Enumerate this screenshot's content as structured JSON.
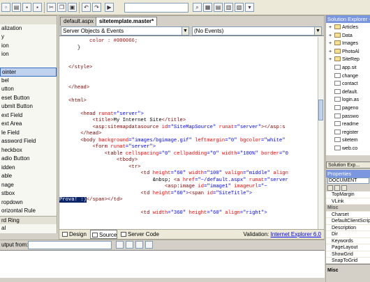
{
  "editor": {
    "tabs": [
      {
        "label": "default.aspx"
      },
      {
        "label": "sitetemplate.master*"
      }
    ],
    "object_combo": "Server Objects & Events",
    "event_combo": "(No Events)",
    "code_lines": [
      {
        "i": 0,
        "segs": [
          {
            "t": "          color : #000066;",
            "c": "css"
          }
        ]
      },
      {
        "i": 1,
        "segs": [
          {
            "t": "      }",
            "c": "txt"
          }
        ]
      },
      {
        "i": 2,
        "segs": []
      },
      {
        "i": 3,
        "segs": []
      },
      {
        "i": 4,
        "segs": [
          {
            "t": "   </style>",
            "c": "tag"
          }
        ]
      },
      {
        "i": 5,
        "segs": []
      },
      {
        "i": 6,
        "segs": []
      },
      {
        "i": 7,
        "segs": [
          {
            "t": "   </head>",
            "c": "tag"
          }
        ]
      },
      {
        "i": 8,
        "segs": []
      },
      {
        "i": 9,
        "segs": [
          {
            "t": "   <html>",
            "c": "tag"
          }
        ]
      },
      {
        "i": 10,
        "segs": []
      },
      {
        "i": 11,
        "segs": [
          {
            "t": "       <head ",
            "c": "tag"
          },
          {
            "t": "runat",
            "c": "attr"
          },
          {
            "t": "=\"server\">",
            "c": "val"
          }
        ]
      },
      {
        "i": 12,
        "segs": [
          {
            "t": "           <title>",
            "c": "tag"
          },
          {
            "t": "My Internet Site",
            "c": "txt"
          },
          {
            "t": "</title>",
            "c": "tag"
          }
        ]
      },
      {
        "i": 13,
        "segs": [
          {
            "t": "           <asp:sitemapdatasource ",
            "c": "tag"
          },
          {
            "t": "id",
            "c": "attr"
          },
          {
            "t": "=\"SiteMapSource\" ",
            "c": "val"
          },
          {
            "t": "runat",
            "c": "attr"
          },
          {
            "t": "=\"server\"",
            "c": "val"
          },
          {
            "t": "></asp:s",
            "c": "tag"
          }
        ]
      },
      {
        "i": 14,
        "segs": [
          {
            "t": "       </head>",
            "c": "tag"
          }
        ]
      },
      {
        "i": 15,
        "segs": [
          {
            "t": "       <body ",
            "c": "tag"
          },
          {
            "t": "background",
            "c": "attr"
          },
          {
            "t": "=\"images/bgimage.gif\" ",
            "c": "val"
          },
          {
            "t": "leftmargin",
            "c": "attr"
          },
          {
            "t": "=\"0\" ",
            "c": "val"
          },
          {
            "t": "bgcolor",
            "c": "attr"
          },
          {
            "t": "=\"white\"",
            "c": "val"
          }
        ]
      },
      {
        "i": 16,
        "segs": [
          {
            "t": "           <form ",
            "c": "tag"
          },
          {
            "t": "runat",
            "c": "attr"
          },
          {
            "t": "=\"server\">",
            "c": "val"
          }
        ]
      },
      {
        "i": 17,
        "segs": [
          {
            "t": "               <table ",
            "c": "tag"
          },
          {
            "t": "cellspacing",
            "c": "attr"
          },
          {
            "t": "=\"0\" ",
            "c": "val"
          },
          {
            "t": "cellpadding",
            "c": "attr"
          },
          {
            "t": "=\"0\" ",
            "c": "val"
          },
          {
            "t": "width",
            "c": "attr"
          },
          {
            "t": "=\"100%\" ",
            "c": "val"
          },
          {
            "t": "border",
            "c": "attr"
          },
          {
            "t": "=\"0",
            "c": "val"
          }
        ]
      },
      {
        "i": 18,
        "segs": [
          {
            "t": "                   <tbody>",
            "c": "tag"
          }
        ]
      },
      {
        "i": 19,
        "segs": [
          {
            "t": "                       <tr>",
            "c": "tag"
          }
        ]
      },
      {
        "i": 20,
        "segs": [
          {
            "t": "                           <td ",
            "c": "tag"
          },
          {
            "t": "height",
            "c": "attr"
          },
          {
            "t": "=\"60\" ",
            "c": "val"
          },
          {
            "t": "width",
            "c": "attr"
          },
          {
            "t": "=\"100\" ",
            "c": "val"
          },
          {
            "t": "valign",
            "c": "attr"
          },
          {
            "t": "=\"middle\" ",
            "c": "val"
          },
          {
            "t": "align",
            "c": "attr"
          }
        ]
      },
      {
        "i": 21,
        "segs": [
          {
            "t": "                               &nbsp; ",
            "c": "txt"
          },
          {
            "t": "<a ",
            "c": "tag"
          },
          {
            "t": "href",
            "c": "attr"
          },
          {
            "t": "=\"~/default.aspx\" ",
            "c": "val"
          },
          {
            "t": "runat",
            "c": "attr"
          },
          {
            "t": "=\"server",
            "c": "val"
          }
        ]
      },
      {
        "i": 22,
        "segs": [
          {
            "t": "                                   <asp:image ",
            "c": "tag"
          },
          {
            "t": "id",
            "c": "attr"
          },
          {
            "t": "=\"image1\" ",
            "c": "val"
          },
          {
            "t": "imageurl",
            "c": "attr"
          },
          {
            "t": "=\"~",
            "c": "val"
          }
        ]
      },
      {
        "i": 23,
        "segs": [
          {
            "t": "                           <td ",
            "c": "tag"
          },
          {
            "t": "height",
            "c": "attr"
          },
          {
            "t": "=\"60\">",
            "c": "val"
          },
          {
            "t": "<span ",
            "c": "tag"
          },
          {
            "t": "id",
            "c": "attr"
          },
          {
            "t": "=\"SiteTitle\">",
            "c": "val"
          }
        ]
      },
      {
        "i": 24,
        "segs": [
          {
            "t": "Prova! :)",
            "c": "hl"
          },
          {
            "t": "</span></td>",
            "c": "tag"
          }
        ]
      },
      {
        "i": 25,
        "segs": []
      },
      {
        "i": 26,
        "segs": [
          {
            "t": "                           <td ",
            "c": "tag"
          },
          {
            "t": "width",
            "c": "attr"
          },
          {
            "t": "=\"360\" ",
            "c": "val"
          },
          {
            "t": "height",
            "c": "attr"
          },
          {
            "t": "=\"60\" ",
            "c": "val"
          },
          {
            "t": "align",
            "c": "attr"
          },
          {
            "t": "=\"right\">",
            "c": "val"
          }
        ]
      }
    ],
    "view_tabs": [
      "Design",
      "Source",
      "Server Code"
    ],
    "validation_label": "Validation:",
    "validation_value": "Internet Explorer 6.0"
  },
  "toolbox": {
    "items": [
      {
        "label": "",
        "type": "hdr"
      },
      {
        "label": "alization",
        "type": "item"
      },
      {
        "label": "y",
        "type": "item"
      },
      {
        "label": "ion",
        "type": "item"
      },
      {
        "label": "ion",
        "type": "item"
      },
      {
        "label": "",
        "type": "item"
      },
      {
        "label": "ointer",
        "type": "sel"
      },
      {
        "label": "bel",
        "type": "item"
      },
      {
        "label": "utton",
        "type": "item"
      },
      {
        "label": "eset Button",
        "type": "item"
      },
      {
        "label": "ubmit Button",
        "type": "item"
      },
      {
        "label": "ext Field",
        "type": "item"
      },
      {
        "label": "ext Area",
        "type": "item"
      },
      {
        "label": "le Field",
        "type": "item"
      },
      {
        "label": "assword Field",
        "type": "item"
      },
      {
        "label": "heckbox",
        "type": "item"
      },
      {
        "label": "adio Button",
        "type": "item"
      },
      {
        "label": "idden",
        "type": "item"
      },
      {
        "label": "able",
        "type": "item"
      },
      {
        "label": "nage",
        "type": "item"
      },
      {
        "label": "stbox",
        "type": "item"
      },
      {
        "label": "ropdown",
        "type": "item"
      },
      {
        "label": "orizontal Rule",
        "type": "item"
      },
      {
        "label": "rd Ring",
        "type": "hdr"
      },
      {
        "label": "al",
        "type": "item"
      }
    ]
  },
  "output": {
    "label": "utput from:"
  },
  "solution": {
    "title": "Solution Explorer - Se",
    "items": [
      {
        "label": "Articles",
        "folder": true,
        "expand": "+"
      },
      {
        "label": "Data",
        "folder": true,
        "expand": "+"
      },
      {
        "label": "Images",
        "folder": true,
        "expand": "+"
      },
      {
        "label": "PhotoAl",
        "folder": true,
        "expand": "+"
      },
      {
        "label": "SiteRep",
        "folder": true,
        "expand": "+"
      },
      {
        "label": "app.sit",
        "folder": false,
        "expand": ""
      },
      {
        "label": "change",
        "folder": false,
        "expand": ""
      },
      {
        "label": "contact",
        "folder": false,
        "expand": ""
      },
      {
        "label": "default.",
        "folder": false,
        "expand": ""
      },
      {
        "label": "login.as",
        "folder": false,
        "expand": ""
      },
      {
        "label": "pageno",
        "folder": false,
        "expand": ""
      },
      {
        "label": "passwo",
        "folder": false,
        "expand": ""
      },
      {
        "label": "readme",
        "folder": false,
        "expand": ""
      },
      {
        "label": "register",
        "folder": false,
        "expand": ""
      },
      {
        "label": "sitetem",
        "folder": false,
        "expand": ""
      },
      {
        "label": "web.co",
        "folder": false,
        "expand": ""
      }
    ],
    "tab_label": "Solution Exp..."
  },
  "properties": {
    "title": "Properties",
    "object_combo": "DOCUMENT",
    "rows": [
      {
        "label": "TopMargin",
        "cat": false
      },
      {
        "label": "VLink",
        "cat": false
      },
      {
        "label": "Misc",
        "cat": true
      },
      {
        "label": "Charset",
        "cat": false
      },
      {
        "label": "DefaultClientScrip",
        "cat": false
      },
      {
        "label": "Description",
        "cat": false
      },
      {
        "label": "Dir",
        "cat": false
      },
      {
        "label": "Keywords",
        "cat": false
      },
      {
        "label": "PageLayout",
        "cat": false
      },
      {
        "label": "ShowGrid",
        "cat": false
      },
      {
        "label": "SnapToGrid",
        "cat": false
      }
    ],
    "description_title": "Misc"
  },
  "colors": {
    "titlebar": "#7a96df",
    "selection": "#0a246a",
    "tag": "#800000",
    "attribute": "#ff0000",
    "value": "#0000ff"
  }
}
